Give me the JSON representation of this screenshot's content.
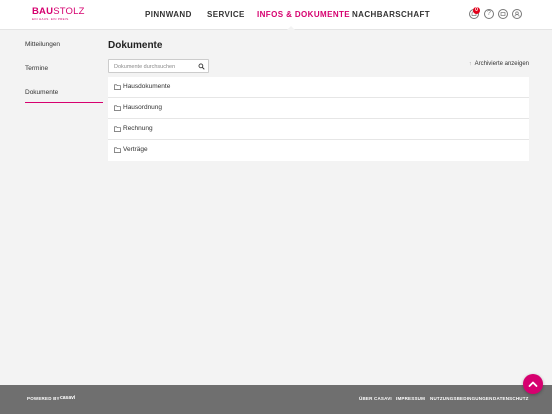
{
  "logo": {
    "bold": "BAU",
    "light": "STOLZ",
    "tagline": "EIN HAUS. EIN PREIS."
  },
  "nav": [
    {
      "label": "PINNWAND"
    },
    {
      "label": "SERVICE"
    },
    {
      "label": "INFOS & DOKUMENTE",
      "active": true
    },
    {
      "label": "NACHBARSCHAFT"
    }
  ],
  "header_icons": {
    "notifications_badge": "0",
    "help": "?"
  },
  "sidebar": [
    {
      "label": "Mitteilungen"
    },
    {
      "label": "Termine"
    },
    {
      "label": "Dokumente",
      "active": true
    }
  ],
  "page": {
    "title": "Dokumente",
    "search_placeholder": "Dokumente durchsuchen",
    "archive_label": "Archivierte anzeigen"
  },
  "documents": [
    {
      "label": "Hausdokumente"
    },
    {
      "label": "Hausordnung"
    },
    {
      "label": "Rechnung"
    },
    {
      "label": "Verträge"
    }
  ],
  "footer": {
    "powered_by": "POWERED BY",
    "brand": "casavi",
    "links": [
      {
        "label": "ÜBER CASAVI"
      },
      {
        "label": "IMPRESSUM"
      },
      {
        "label": "NUTZUNGSBEDINGUNGEN"
      },
      {
        "label": "DATENSCHUTZ"
      }
    ]
  },
  "colors": {
    "accent": "#d6006f",
    "footer": "#6f6f6f",
    "background": "#f3f3f3"
  }
}
